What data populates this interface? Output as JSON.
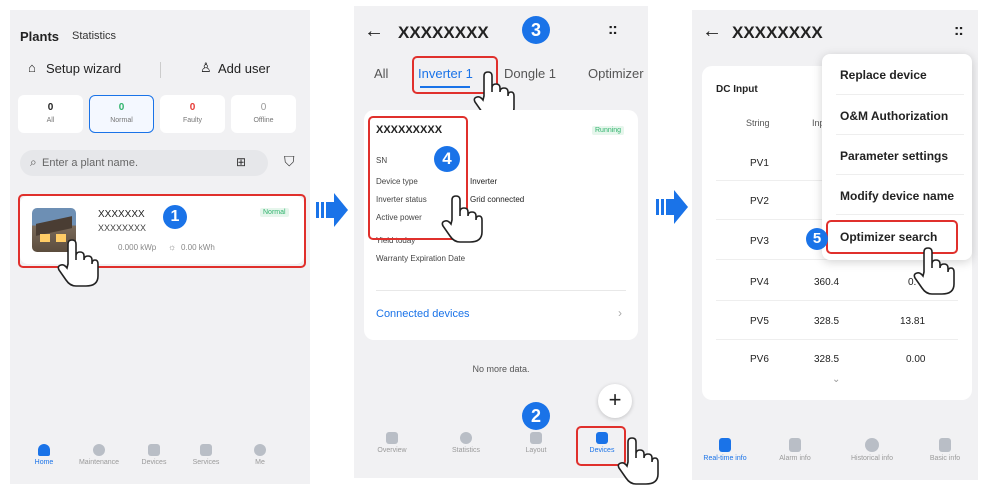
{
  "screen1": {
    "tab_plants": "Plants",
    "tab_statistics": "Statistics",
    "setup_wizard": "Setup wizard",
    "add_user": "Add user",
    "filters": [
      {
        "count": "0",
        "label": "All"
      },
      {
        "count": "0",
        "label": "Normal"
      },
      {
        "count": "0",
        "label": "Faulty"
      },
      {
        "count": "0",
        "label": "Offline"
      }
    ],
    "search_placeholder": "Enter a plant name.",
    "plant": {
      "name": "XXXXXXX",
      "sub": "XXXXXXXX",
      "status": "Normal",
      "capacity": "0.000 kWp",
      "energy": "0.00 kWh"
    },
    "step": "1",
    "nav": [
      "Home",
      "Maintenance",
      "Devices",
      "Services",
      "Me"
    ]
  },
  "screen2": {
    "title": "XXXXXXXX",
    "step_title": "3",
    "tabs": [
      "All",
      "Inverter 1",
      "Dongle 1",
      "Optimizer"
    ],
    "device_name": "XXXXXXXXX",
    "status": "Running",
    "rows": [
      {
        "label": "SN",
        "value": ""
      },
      {
        "label": "Device type",
        "value": "Inverter"
      },
      {
        "label": "Inverter status",
        "value": "Grid connected"
      },
      {
        "label": "Active power",
        "value": ""
      },
      {
        "label": "Yield today",
        "value": ""
      },
      {
        "label": "Warranty Expiration Date",
        "value": ""
      }
    ],
    "step_card": "4",
    "connected": "Connected devices",
    "no_more": "No more data.",
    "plus": "+",
    "step_nav": "2",
    "nav": [
      "Overview",
      "Statistics",
      "Layout",
      "Devices"
    ]
  },
  "screen3": {
    "title": "XXXXXXXX",
    "section": "DC Input",
    "col_string": "String",
    "col_input": "Input",
    "rows": [
      {
        "s": "PV1",
        "v": "",
        "c": ""
      },
      {
        "s": "PV2",
        "v": "",
        "c": ""
      },
      {
        "s": "PV3",
        "v": "",
        "c": ""
      },
      {
        "s": "PV4",
        "v": "360.4",
        "c": "0."
      },
      {
        "s": "PV5",
        "v": "328.5",
        "c": "13.81"
      },
      {
        "s": "PV6",
        "v": "328.5",
        "c": "0.00"
      }
    ],
    "menu": [
      "Replace device",
      "O&M Authorization",
      "Parameter settings",
      "Modify device name",
      "Optimizer search"
    ],
    "step": "5",
    "nav": [
      "Real-time info",
      "Alarm info",
      "Historical info",
      "Basic info"
    ]
  },
  "colors": {
    "accent": "#1a73e8",
    "callout": "#e0302c",
    "normal": "#2fb36c",
    "faulty": "#e53935"
  }
}
